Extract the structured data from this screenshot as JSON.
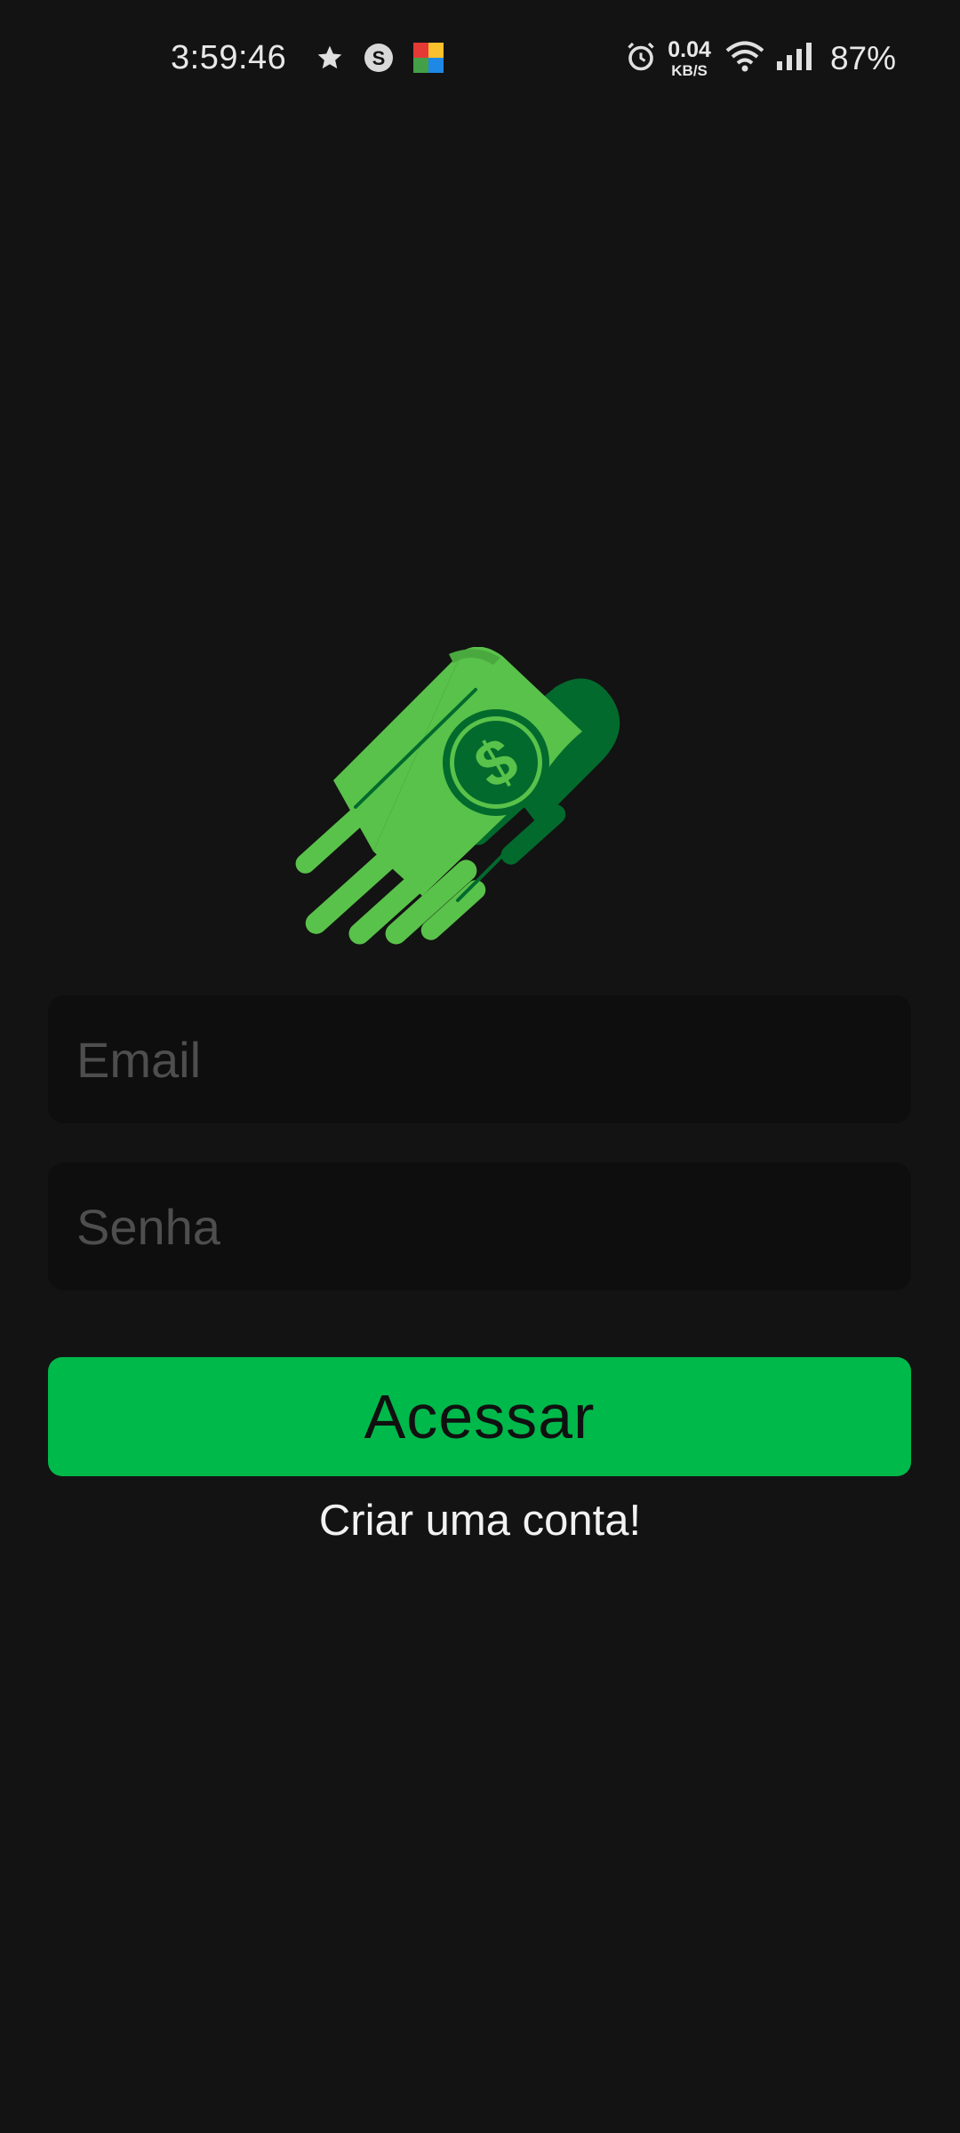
{
  "status_bar": {
    "time": "3:59:46",
    "net_speed_value": "0.04",
    "net_speed_unit": "KB/S",
    "battery": "87%",
    "icons": [
      "star-icon",
      "s-circle-icon",
      "keyboard-app-icon",
      "alarm-icon",
      "wifi-icon",
      "signal-icon"
    ]
  },
  "login": {
    "logo_icon": "flying-money-icon",
    "email_placeholder": "Email",
    "email_value": "",
    "password_placeholder": "Senha",
    "password_value": "",
    "submit_label": "Acessar",
    "create_account_label": "Criar uma conta!"
  },
  "colors": {
    "background": "#131313",
    "input_background": "#0e0e0e",
    "accent": "#00b94b",
    "logo_light_green": "#59c24a",
    "logo_dark_green": "#036a2d"
  }
}
